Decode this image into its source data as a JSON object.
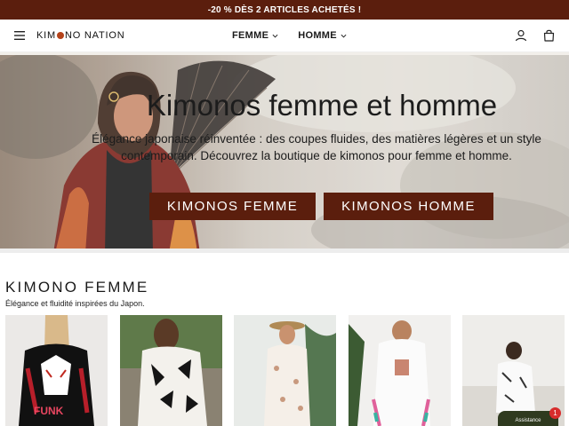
{
  "promo": {
    "text": "-20 % DÈS 2 ARTICLES ACHETÉS !"
  },
  "header": {
    "logo_before": "KIM",
    "logo_after": "NO NATION",
    "nav": [
      {
        "label": "FEMME",
        "icon": "chevron-down-icon"
      },
      {
        "label": "HOMME",
        "icon": "chevron-down-icon"
      }
    ],
    "icons": [
      "menu-icon",
      "account-icon",
      "cart-icon"
    ]
  },
  "hero": {
    "title": "Kimonos femme et homme",
    "text": "Élégance japonaise réinventée : des coupes fluides, des matières légères et un style contemporain. Découvrez la boutique de kimonos pour femme et homme.",
    "buttons": [
      "KIMONOS FEMME",
      "KIMONOS HOMME"
    ]
  },
  "section": {
    "title": "KIMONO FEMME",
    "subtitle": "Élégance et fluidité inspirées du Japon."
  },
  "products": [
    {
      "name": "kimono-fox-black"
    },
    {
      "name": "kimono-bird-print"
    },
    {
      "name": "kimono-white-floral"
    },
    {
      "name": "kimono-white-fringe"
    },
    {
      "name": "kimono-white-pattern"
    }
  ],
  "chat": {
    "label": "Assistance",
    "badge": "1"
  },
  "colors": {
    "brand": "#5b1e0d",
    "promo_bg": "#5b1e0d",
    "logo_dot": "#b4431a"
  }
}
